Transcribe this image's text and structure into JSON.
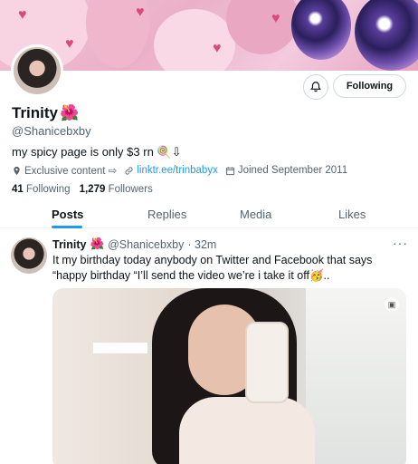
{
  "profile": {
    "name": "Trinity",
    "name_emoji": "🌺",
    "handle": "@Shanicebxby",
    "bio": "my spicy page is only $3 rn 🍭⇩",
    "meta": {
      "category": "Exclusive content ⇨",
      "link": "linktr.ee/trinbabyx",
      "joined": "Joined September 2011"
    },
    "following_count": "41",
    "following_label": "Following",
    "followers_count": "1,279",
    "followers_label": "Followers"
  },
  "actions": {
    "follow_label": "Following"
  },
  "tabs": [
    {
      "label": "Posts"
    },
    {
      "label": "Replies"
    },
    {
      "label": "Media"
    },
    {
      "label": "Likes"
    }
  ],
  "tweet": {
    "name": "Trinity",
    "name_emoji": "🌺",
    "handle": "@Shanicebxby",
    "time": "· 32m",
    "text": "It my birthday today anybody on Twitter and Facebook that says “happy birthday “I’ll send the video we’re i take it off🥳..",
    "more": "···"
  },
  "colors": {
    "accent": "#1d9bf0",
    "secondary_text": "#536471"
  }
}
